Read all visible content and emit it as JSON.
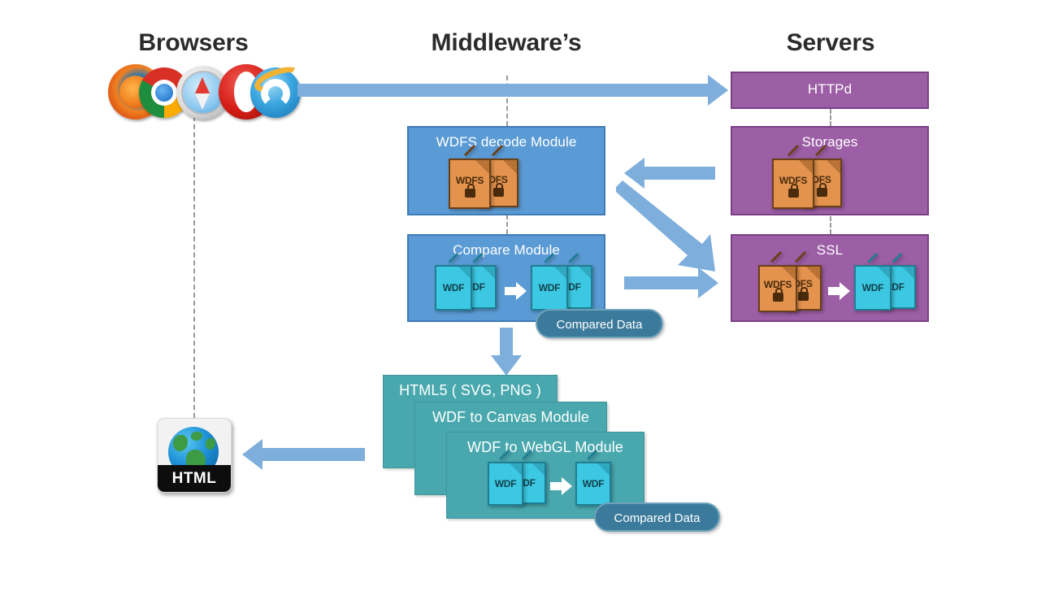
{
  "columns": {
    "browsers": {
      "title": "Browsers"
    },
    "middleware": {
      "title": "Middleware’s"
    },
    "servers": {
      "title": "Servers"
    }
  },
  "browser_icons": [
    {
      "name": "firefox-icon"
    },
    {
      "name": "chrome-icon"
    },
    {
      "name": "safari-icon"
    },
    {
      "name": "opera-icon"
    },
    {
      "name": "internet-explorer-icon"
    }
  ],
  "middleware_boxes": [
    {
      "label": "WDFS decode Module"
    },
    {
      "label": "Compare Module"
    }
  ],
  "server_boxes": [
    {
      "label": "HTTPd"
    },
    {
      "label": "Storages"
    },
    {
      "label": "SSL"
    }
  ],
  "output_cards": [
    {
      "label": "HTML5 ( SVG, PNG )"
    },
    {
      "label": "WDF to Canvas Module"
    },
    {
      "label": "WDF to WebGL Module"
    }
  ],
  "documents": {
    "wdfs_primary": "WDFS",
    "wdfs_secondary": "DFS",
    "wdf_primary": "WDF",
    "wdf_secondary": "DF"
  },
  "badges": {
    "compare_module": "Compared Data",
    "webgl_module": "Compared Data"
  },
  "html_output": {
    "label": "HTML"
  },
  "colors": {
    "blue_box": "#5B9BD5",
    "purple_box": "#9C5EA5",
    "teal_card": "#49A8AE",
    "arrow": "#7EAEDC",
    "badge": "#3B7A9B",
    "doc_orange": "#E3934E",
    "doc_cyan": "#3CC8E2",
    "dashed_guide": "#9A9A9A",
    "heading": "#2B2B2B"
  }
}
